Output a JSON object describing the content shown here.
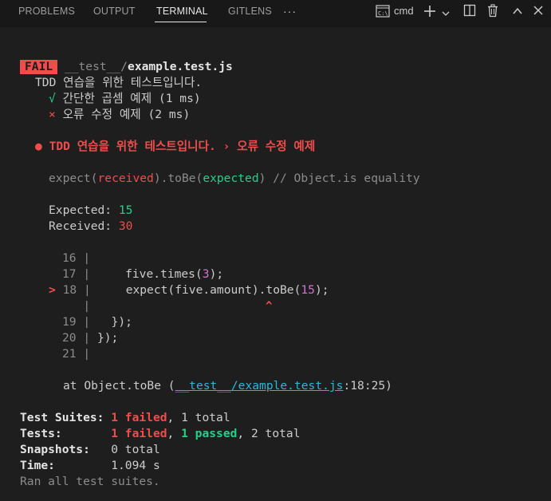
{
  "panel": {
    "tabs": [
      "PROBLEMS",
      "OUTPUT",
      "TERMINAL",
      "GITLENS"
    ],
    "active_tab": "TERMINAL",
    "more": "···",
    "terminal_name": "cmd",
    "icons": [
      "terminal-icon",
      "plus-icon",
      "chevron-down-icon",
      "split-icon",
      "trash-icon",
      "chevron-up-icon",
      "close-icon"
    ]
  },
  "output": {
    "fail_badge": "FAIL",
    "test_path_dir": "__test__/",
    "test_path_file": "example.test.js",
    "describe": "TDD 연습을 위한 테스트입니다.",
    "pass_mark": "√",
    "pass_test": "간단한 곱셈 예제 (1 ms)",
    "fail_mark": "×",
    "fail_test": "오류 수정 예제 (2 ms)",
    "error_bullet": "●",
    "error_title": "TDD 연습을 위한 테스트입니다. › 오류 수정 예제",
    "expect_pre": "expect(",
    "expect_received": "received",
    "expect_mid": ").toBe(",
    "expect_expected": "expected",
    "expect_post": ") // Object.is equality",
    "expected_label": "Expected: ",
    "expected_value": "15",
    "received_label": "Received: ",
    "received_value": "30",
    "code": {
      "ln16": "16",
      "ln17": "17",
      "ln18": "18",
      "ln19": "19",
      "ln20": "20",
      "ln21": "21",
      "bar": "|",
      "marker": ">",
      "l17_a": "five.times(",
      "l17_num": "3",
      "l17_b": ");",
      "l18_a": "expect(five.amount)",
      "l18_b": ".toBe(",
      "l18_num": "15",
      "l18_c": ");",
      "caret": "^",
      "l19": "});",
      "l20_a": "});",
      "l20_b": ";"
    },
    "stack_pre": "at Object.toBe (",
    "stack_link": "__test__/example.test.js",
    "stack_loc": ":18:25)",
    "summary": {
      "suites_label": "Test Suites:",
      "suites_failed": "1 failed",
      "suites_rest": ", 1 total",
      "tests_label": "Tests:",
      "tests_failed": "1 failed",
      "tests_sep": ", ",
      "tests_passed": "1 passed",
      "tests_rest": ", 2 total",
      "snapshots_label": "Snapshots:",
      "snapshots_value": "0 total",
      "time_label": "Time:",
      "time_value": "1.094 s",
      "ran_all": "Ran all test suites."
    }
  },
  "colors": {
    "background": "#1e1e1e",
    "fail_red": "#f14c4c",
    "pass_green": "#23d18b",
    "bracket_yellow": "#f5f543",
    "number_magenta": "#d670d6",
    "link_cyan": "#29b8db"
  }
}
